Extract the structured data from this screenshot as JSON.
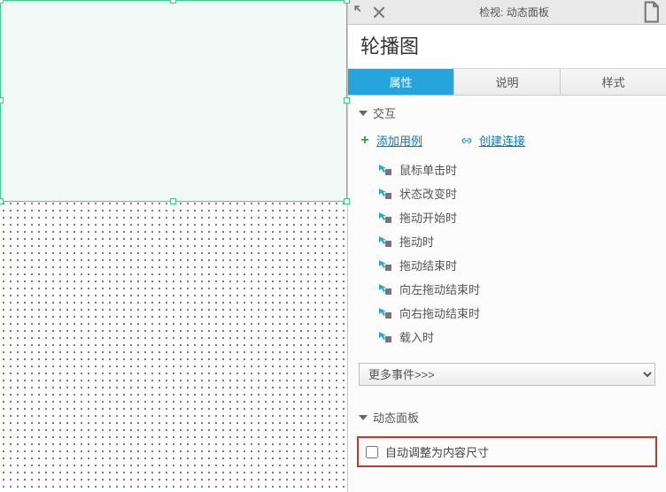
{
  "inspector": {
    "header": {
      "title_prefix": "检视:",
      "title_object": "动态面板"
    },
    "widget_name": "轮播图",
    "tabs": [
      "属性",
      "说明",
      "样式"
    ],
    "active_tab_index": 0,
    "sections": {
      "interactions": {
        "label": "交互",
        "add_case": "添加用例",
        "create_link": "创建连接",
        "events": [
          "鼠标单击时",
          "状态改变时",
          "拖动开始时",
          "拖动时",
          "拖动结束时",
          "向左拖动结束时",
          "向右拖动结束时",
          "载入时"
        ],
        "more_events_label": "更多事件>>>"
      },
      "dynamic_panel": {
        "label": "动态面板",
        "fit_to_content": {
          "label": "自动调整为内容尺寸",
          "checked": false
        }
      }
    }
  },
  "icons": {
    "expand": "expand-icon",
    "close": "close-icon",
    "page": "page-icon",
    "plus": "plus-icon",
    "link": "link-icon",
    "event_cursor": "event-cursor-icon",
    "chevron_down": "chevron-down-icon"
  }
}
